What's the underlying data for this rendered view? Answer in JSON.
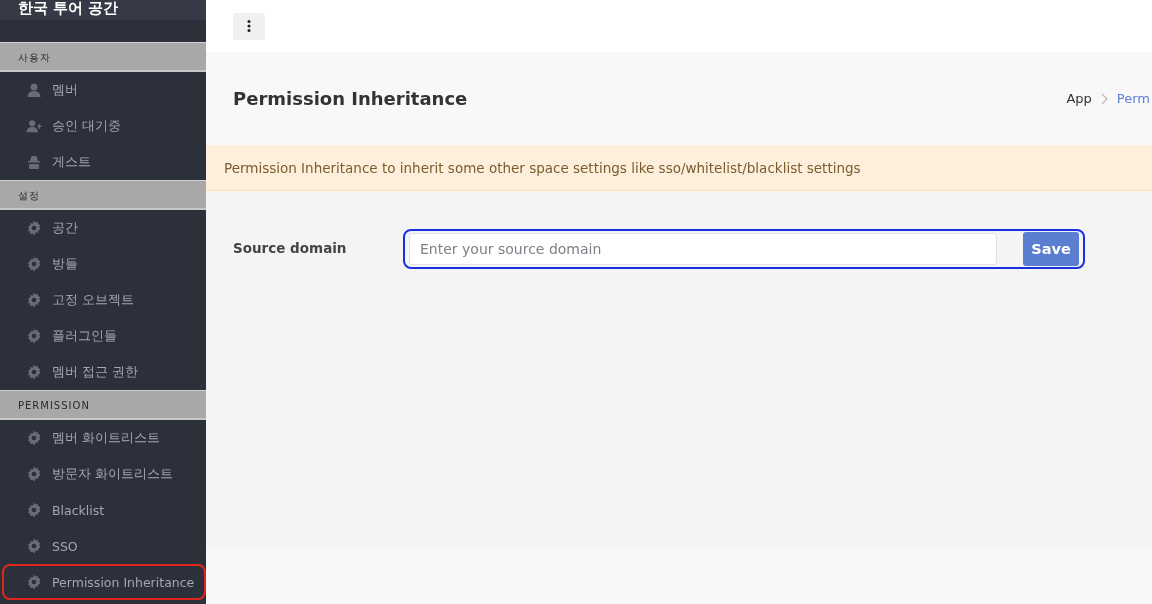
{
  "sidebar": {
    "title": "한국 투어 공간",
    "sections": [
      {
        "heading": "사용자",
        "items": [
          {
            "label": "멤버",
            "kind": "person",
            "selected": false
          },
          {
            "label": "승인 대기중",
            "kind": "person-add",
            "selected": false
          },
          {
            "label": "게스트",
            "kind": "guest",
            "selected": false
          }
        ]
      },
      {
        "heading": "설정",
        "items": [
          {
            "label": "공간",
            "kind": "gear",
            "selected": false
          },
          {
            "label": "방들",
            "kind": "gear",
            "selected": false
          },
          {
            "label": "고정 오브젝트",
            "kind": "gear",
            "selected": false
          },
          {
            "label": "플러그인들",
            "kind": "gear",
            "selected": false
          },
          {
            "label": "멤버 접근 권한",
            "kind": "gear",
            "selected": false
          }
        ]
      },
      {
        "heading": "PERMISSION",
        "items": [
          {
            "label": "멤버 화이트리스트",
            "kind": "gear",
            "selected": false
          },
          {
            "label": "방문자 화이트리스트",
            "kind": "gear",
            "selected": false
          },
          {
            "label": "Blacklist",
            "kind": "gear",
            "selected": false
          },
          {
            "label": "SSO",
            "kind": "gear",
            "selected": false
          },
          {
            "label": "Permission Inheritance",
            "kind": "gear",
            "selected": true
          }
        ]
      }
    ]
  },
  "page": {
    "title": "Permission Inheritance",
    "breadcrumb": [
      {
        "label": "App",
        "selected": false
      },
      {
        "label": "Perm",
        "selected": true
      }
    ],
    "alert": "Permission Inheritance to inherit some other space settings like sso/whitelist/blacklist settings",
    "form": {
      "label": "Source domain",
      "placeholder": "Enter your source domain",
      "button": "Save",
      "focused": true
    }
  }
}
